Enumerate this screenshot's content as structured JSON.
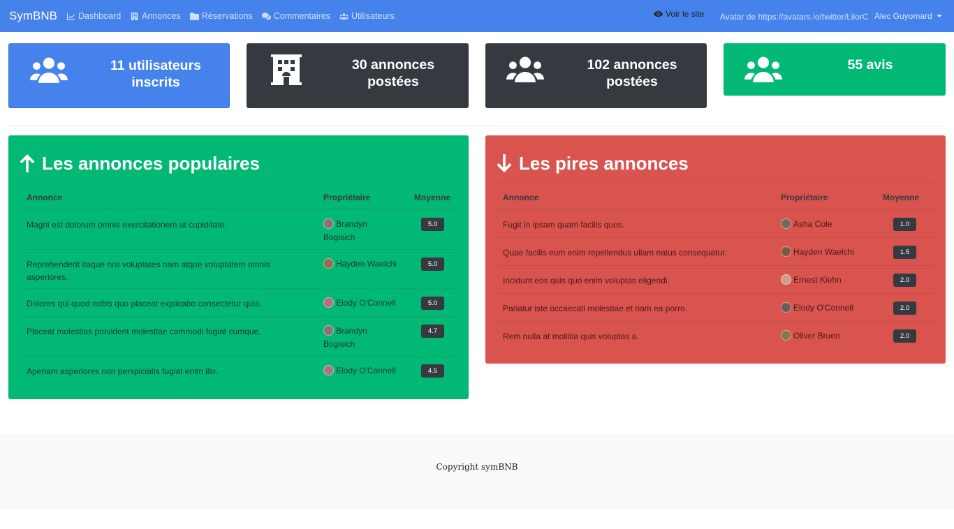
{
  "navbar": {
    "brand": "SymBNB",
    "links": [
      {
        "label": "Dashboard",
        "icon": "chart-icon"
      },
      {
        "label": "Annonces",
        "icon": "building-icon"
      },
      {
        "label": "Réservations",
        "icon": "folder-icon"
      },
      {
        "label": "Commentaires",
        "icon": "comments-icon"
      },
      {
        "label": "Utilisateurs",
        "icon": "users-icon"
      }
    ],
    "view_site": "Voir le site",
    "avatar_alt": "Avatar de https://avatars.io/twitter/LiiorC",
    "user_name": "Alec Guyomard"
  },
  "stats": [
    {
      "line1": "11 utilisateurs",
      "line2": "inscrits",
      "icon": "users-icon",
      "color": "#4582ec"
    },
    {
      "line1": "30 annonces",
      "line2": "postées",
      "icon": "building-icon",
      "color": "#343a40"
    },
    {
      "line1": "102 annonces",
      "line2": "postées",
      "icon": "users-icon",
      "color": "#343a40"
    },
    {
      "line1": "55 avis",
      "line2": "",
      "icon": "users-icon",
      "color": "#02b875"
    }
  ],
  "best": {
    "title": "Les annonces populaires",
    "headers": {
      "ad": "Annonce",
      "owner": "Propriétaire",
      "avg": "Moyenne"
    },
    "rows": [
      {
        "title": "Magni est dolorum omnis exercitationem ut cupiditate.",
        "owner": "Brandyn Bogisich",
        "avg": "5.0"
      },
      {
        "title": "Reprehenderit itaque nisi voluptates nam atque voluptatem omnis asperiores.",
        "owner": "Hayden Waelchi",
        "avg": "5.0"
      },
      {
        "title": "Dolores qui quod nobis quo placeat explicabo consectetur quia.",
        "owner": "Elody O'Connell",
        "avg": "5.0"
      },
      {
        "title": "Placeat molestias provident molestiae commodi fugiat cumque.",
        "owner": "Brandyn Bogisich",
        "avg": "4.7"
      },
      {
        "title": "Aperiam asperiores non perspiciatis fugiat enim illo.",
        "owner": "Elody O'Connell",
        "avg": "4.5"
      }
    ]
  },
  "worst": {
    "title": "Les pires annonces",
    "headers": {
      "ad": "Annonce",
      "owner": "Propriétaire",
      "avg": "Moyenne"
    },
    "rows": [
      {
        "title": "Fugit in ipsam quam facilis quos.",
        "owner": "Asha Cole",
        "avg": "1.0"
      },
      {
        "title": "Quae facilis eum enim repellendus ullam natus consequatur.",
        "owner": "Hayden Waelchi",
        "avg": "1.5"
      },
      {
        "title": "Incidunt eos quis quo enim voluptas eligendi.",
        "owner": "Ernest Kiehn",
        "avg": "2.0"
      },
      {
        "title": "Pariatur iste occaecati molestiae et nam ea porro.",
        "owner": "Elody O'Connell",
        "avg": "2.0"
      },
      {
        "title": "Rem nulla at mollitia quis voluptas a.",
        "owner": "Oliver Bruen",
        "avg": "2.0"
      }
    ]
  },
  "footer": {
    "copyright": "Copyright symBNB"
  },
  "colors": {
    "primary": "#4582ec",
    "dark": "#343a40",
    "success": "#02b875",
    "danger": "#d9534f"
  }
}
